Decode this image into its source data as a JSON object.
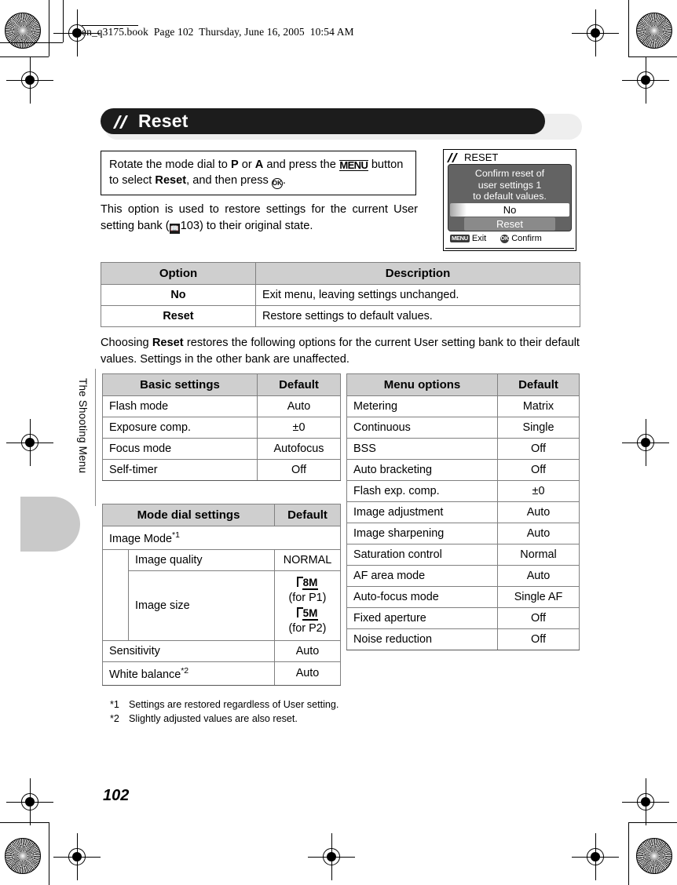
{
  "print_header": {
    "text": "en_q3175.book  Page 102  Thursday, June 16, 2005  10:54 AM"
  },
  "chapter_tab": {
    "label": "The Shooting Menu"
  },
  "page_number": "102",
  "title": {
    "text": "Reset",
    "icon": "double-slash-icon"
  },
  "instruction": {
    "part1": "Rotate the mode dial to ",
    "bold_p": "P",
    "part2": " or ",
    "bold_a": "A",
    "part3": " and press the ",
    "menu_icon_label": "MENU",
    "part4": " button to select ",
    "bold_reset": "Reset",
    "part5": ", and then press ",
    "ok_icon_label": "OK",
    "part6": "."
  },
  "paragraph_1": {
    "before_ref": "This option is used to restore settings for the current User setting bank (",
    "ref_icon": "book-ref-icon",
    "ref_page": "103",
    "after_ref": ") to their original state."
  },
  "paragraph_2": {
    "part1": "Choosing ",
    "bold": "Reset",
    "part2": " restores the following options for the current User setting bank to their default values. Settings in the other bank are unaffected."
  },
  "lcd": {
    "title": "RESET",
    "title_icon": "double-slash-icon",
    "message_lines": [
      "Confirm reset of",
      "user settings 1",
      "to default values."
    ],
    "options": [
      {
        "label": "No",
        "state": "selected-highlight"
      },
      {
        "label": "Reset",
        "state": "unselected"
      }
    ],
    "footer": [
      {
        "chip": "MENU",
        "label": "Exit"
      },
      {
        "chip": "OK",
        "label": "Confirm"
      }
    ]
  },
  "option_table": {
    "headers": [
      "Option",
      "Description"
    ],
    "rows": [
      {
        "option": "No",
        "description": "Exit menu, leaving settings unchanged."
      },
      {
        "option": "Reset",
        "description": "Restore settings to default values."
      }
    ]
  },
  "basic_settings_table": {
    "headers": [
      "Basic settings",
      "Default"
    ],
    "rows": [
      {
        "setting": "Flash mode",
        "default": "Auto"
      },
      {
        "setting": "Exposure comp.",
        "default": "±0"
      },
      {
        "setting": "Focus mode",
        "default": "Autofocus"
      },
      {
        "setting": "Self-timer",
        "default": "Off"
      }
    ]
  },
  "menu_options_table": {
    "headers": [
      "Menu options",
      "Default"
    ],
    "rows": [
      {
        "setting": "Metering",
        "default": "Matrix"
      },
      {
        "setting": "Continuous",
        "default": "Single"
      },
      {
        "setting": "BSS",
        "default": "Off"
      },
      {
        "setting": "Auto bracketing",
        "default": "Off"
      },
      {
        "setting": "Flash exp. comp.",
        "default": "±0"
      },
      {
        "setting": "Image adjustment",
        "default": "Auto"
      },
      {
        "setting": "Image sharpening",
        "default": "Auto"
      },
      {
        "setting": "Saturation control",
        "default": "Normal"
      },
      {
        "setting": "AF area mode",
        "default": "Auto"
      },
      {
        "setting": "Auto-focus mode",
        "default": "Single AF"
      },
      {
        "setting": "Fixed aperture",
        "default": "Off"
      },
      {
        "setting": "Noise reduction",
        "default": "Off"
      }
    ]
  },
  "mode_dial_table": {
    "headers": [
      "Mode dial settings",
      "Default"
    ],
    "group_label": "Image Mode",
    "group_footnote": "*1",
    "sub_rows": [
      {
        "setting": "Image quality",
        "default": "NORMAL"
      }
    ],
    "image_size": {
      "setting": "Image size",
      "size1": "8M",
      "size1_note": "(for P1)",
      "size2": "5M",
      "size2_note": "(for P2)"
    },
    "rows": [
      {
        "setting": "Sensitivity",
        "footnote": "",
        "default": "Auto"
      },
      {
        "setting": "White balance",
        "footnote": "*2",
        "default": "Auto"
      }
    ]
  },
  "footnotes": [
    {
      "mark": "*1",
      "text": "Settings are restored regardless of User setting."
    },
    {
      "mark": "*2",
      "text": "Slightly adjusted values are also reset."
    }
  ]
}
